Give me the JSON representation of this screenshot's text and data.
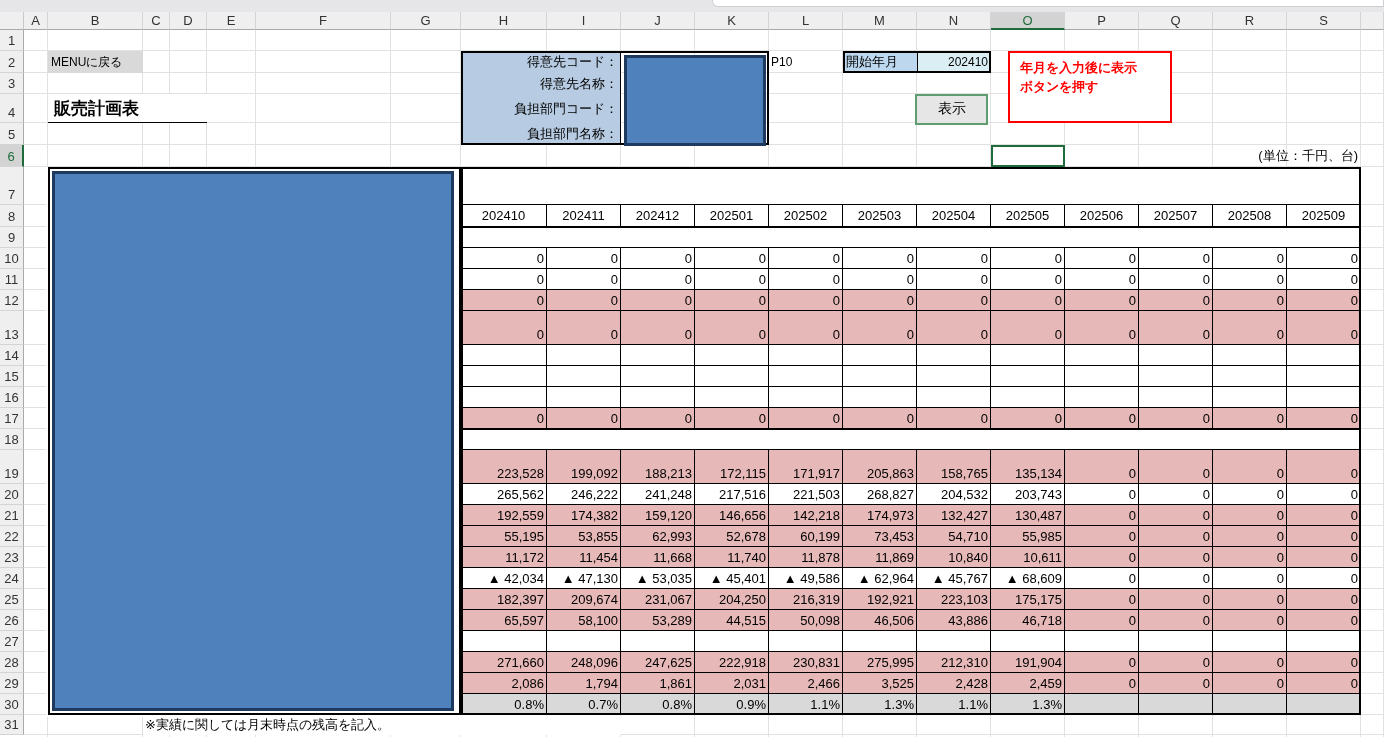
{
  "column_headers": [
    {
      "label": "A",
      "selected": false
    },
    {
      "label": "B",
      "selected": false
    },
    {
      "label": "C",
      "selected": false
    },
    {
      "label": "D",
      "selected": false
    },
    {
      "label": "E",
      "selected": false
    },
    {
      "label": "F",
      "selected": false
    },
    {
      "label": "G",
      "selected": false
    },
    {
      "label": "H",
      "selected": false
    },
    {
      "label": "I",
      "selected": false
    },
    {
      "label": "J",
      "selected": false
    },
    {
      "label": "K",
      "selected": false
    },
    {
      "label": "L",
      "selected": false
    },
    {
      "label": "M",
      "selected": false
    },
    {
      "label": "N",
      "selected": false
    },
    {
      "label": "O",
      "selected": true
    },
    {
      "label": "P",
      "selected": false
    },
    {
      "label": "Q",
      "selected": false
    },
    {
      "label": "R",
      "selected": false
    },
    {
      "label": "S",
      "selected": false
    }
  ],
  "row_headers": [
    {
      "label": "1",
      "selected": false
    },
    {
      "label": "2",
      "selected": false
    },
    {
      "label": "3",
      "selected": false
    },
    {
      "label": "4",
      "selected": false
    },
    {
      "label": "5",
      "selected": false
    },
    {
      "label": "6",
      "selected": true
    },
    {
      "label": "7",
      "selected": false
    },
    {
      "label": "8",
      "selected": false
    },
    {
      "label": "9",
      "selected": false
    },
    {
      "label": "10",
      "selected": false
    },
    {
      "label": "11",
      "selected": false
    },
    {
      "label": "12",
      "selected": false
    },
    {
      "label": "13",
      "selected": false
    },
    {
      "label": "14",
      "selected": false
    },
    {
      "label": "15",
      "selected": false
    },
    {
      "label": "16",
      "selected": false
    },
    {
      "label": "17",
      "selected": false
    },
    {
      "label": "18",
      "selected": false
    },
    {
      "label": "19",
      "selected": false
    },
    {
      "label": "20",
      "selected": false
    },
    {
      "label": "21",
      "selected": false
    },
    {
      "label": "22",
      "selected": false
    },
    {
      "label": "23",
      "selected": false
    },
    {
      "label": "24",
      "selected": false
    },
    {
      "label": "25",
      "selected": false
    },
    {
      "label": "26",
      "selected": false
    },
    {
      "label": "27",
      "selected": false
    },
    {
      "label": "28",
      "selected": false
    },
    {
      "label": "29",
      "selected": false
    },
    {
      "label": "30",
      "selected": false
    },
    {
      "label": "31",
      "selected": false
    }
  ],
  "menu_button": "MENUに戻る",
  "title": "販売計画表",
  "customer_fields": [
    "得意先コード：",
    "得意先名称：",
    "負担部門コード：",
    "負担部門名称："
  ],
  "code_suffix": "P10",
  "start_month": {
    "label": "開始年月",
    "value": "202410"
  },
  "show_button": "表示",
  "instruction_note": "年月を入力後に表示ボタンを押す",
  "unit_note": "(単位：千円、台)",
  "months": [
    "202410",
    "202411",
    "202412",
    "202501",
    "202502",
    "202503",
    "202504",
    "202505",
    "202506",
    "202507",
    "202508",
    "202509"
  ],
  "rows": [
    {
      "kind": "merged"
    },
    {
      "kind": "white",
      "cells": [
        "0",
        "0",
        "0",
        "0",
        "0",
        "0",
        "0",
        "0",
        "0",
        "0",
        "0",
        "0"
      ]
    },
    {
      "kind": "white",
      "cells": [
        "0",
        "0",
        "0",
        "0",
        "0",
        "0",
        "0",
        "0",
        "0",
        "0",
        "0",
        "0"
      ]
    },
    {
      "kind": "pink",
      "cells": [
        "0",
        "0",
        "0",
        "0",
        "0",
        "0",
        "0",
        "0",
        "0",
        "0",
        "0",
        "0"
      ]
    },
    {
      "kind": "pink",
      "cells": [
        "0",
        "0",
        "0",
        "0",
        "0",
        "0",
        "0",
        "0",
        "0",
        "0",
        "0",
        "0"
      ]
    },
    {
      "kind": "white"
    },
    {
      "kind": "white"
    },
    {
      "kind": "white"
    },
    {
      "kind": "pink",
      "cells": [
        "0",
        "0",
        "0",
        "0",
        "0",
        "0",
        "0",
        "0",
        "0",
        "0",
        "0",
        "0"
      ]
    },
    {
      "kind": "merged"
    },
    {
      "kind": "pink",
      "cells": [
        "223,528",
        "199,092",
        "188,213",
        "172,115",
        "171,917",
        "205,863",
        "158,765",
        "135,134",
        "0",
        "0",
        "0",
        "0"
      ]
    },
    {
      "kind": "white",
      "cells": [
        "265,562",
        "246,222",
        "241,248",
        "217,516",
        "221,503",
        "268,827",
        "204,532",
        "203,743",
        "0",
        "0",
        "0",
        "0"
      ]
    },
    {
      "kind": "pink",
      "cells": [
        "192,559",
        "174,382",
        "159,120",
        "146,656",
        "142,218",
        "174,973",
        "132,427",
        "130,487",
        "0",
        "0",
        "0",
        "0"
      ]
    },
    {
      "kind": "pink",
      "cells": [
        "55,195",
        "53,855",
        "62,993",
        "52,678",
        "60,199",
        "73,453",
        "54,710",
        "55,985",
        "0",
        "0",
        "0",
        "0"
      ]
    },
    {
      "kind": "pink",
      "cells": [
        "11,172",
        "11,454",
        "11,668",
        "11,740",
        "11,878",
        "11,869",
        "10,840",
        "10,611",
        "0",
        "0",
        "0",
        "0"
      ]
    },
    {
      "kind": "white",
      "cells": [
        "▲ 42,034",
        "▲ 47,130",
        "▲ 53,035",
        "▲ 45,401",
        "▲ 49,586",
        "▲ 62,964",
        "▲ 45,767",
        "▲ 68,609",
        "0",
        "0",
        "0",
        "0"
      ]
    },
    {
      "kind": "pink",
      "cells": [
        "182,397",
        "209,674",
        "231,067",
        "204,250",
        "216,319",
        "192,921",
        "223,103",
        "175,175",
        "0",
        "0",
        "0",
        "0"
      ]
    },
    {
      "kind": "pink",
      "cells": [
        "65,597",
        "58,100",
        "53,289",
        "44,515",
        "50,098",
        "46,506",
        "43,886",
        "46,718",
        "0",
        "0",
        "0",
        "0"
      ]
    },
    {
      "kind": "white"
    },
    {
      "kind": "pink",
      "cells": [
        "271,660",
        "248,096",
        "247,625",
        "222,918",
        "230,831",
        "275,995",
        "212,310",
        "191,904",
        "0",
        "0",
        "0",
        "0"
      ]
    },
    {
      "kind": "pink",
      "cells": [
        "2,086",
        "1,794",
        "1,861",
        "2,031",
        "2,466",
        "3,525",
        "2,428",
        "2,459",
        "0",
        "0",
        "0",
        "0"
      ]
    },
    {
      "kind": "gray",
      "cells": [
        "0.8%",
        "0.7%",
        "0.8%",
        "0.9%",
        "1.1%",
        "1.3%",
        "1.1%",
        "1.3%"
      ]
    }
  ],
  "footnote": "※実績に関しては月末時点の残高を記入。"
}
